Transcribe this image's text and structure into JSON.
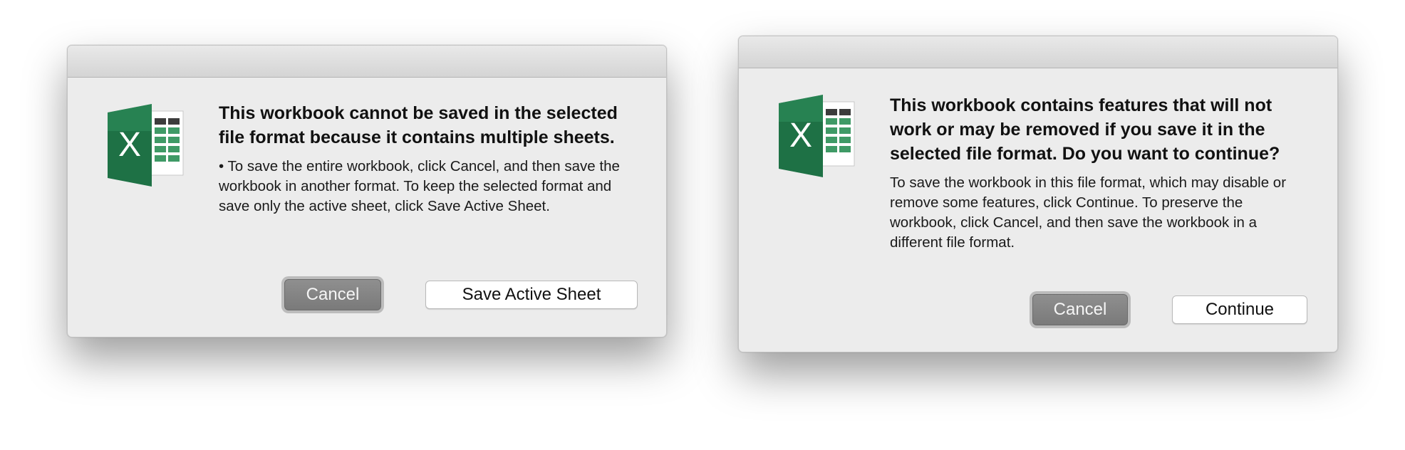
{
  "dialogs": [
    {
      "headline": "This workbook cannot be saved in the selected file format because it contains multiple sheets.",
      "body": "• To save the entire workbook, click Cancel, and then save the workbook in another format. To keep the selected format and save only the active sheet, click Save Active Sheet.",
      "buttons": {
        "default_label": "Cancel",
        "secondary_label": "Save Active Sheet"
      }
    },
    {
      "headline": "This workbook contains features that will not work or may be removed if you save it in the selected file format. Do you want to continue?",
      "body": "To save the workbook in this file format, which may disable or remove some features, click Continue. To preserve the workbook, click Cancel, and then save the workbook in a different file format.",
      "buttons": {
        "default_label": "Cancel",
        "secondary_label": "Continue"
      }
    }
  ],
  "icon": {
    "name": "excel-app-icon",
    "letter": "X",
    "colors": {
      "brand_green": "#1e7145",
      "brand_green_light": "#33a06a",
      "sheet_cell": "#3f9a66",
      "sheet_header": "#3c3c3c"
    }
  }
}
